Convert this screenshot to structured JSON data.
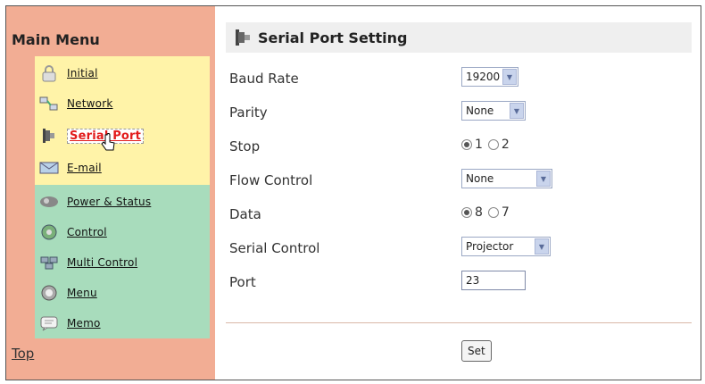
{
  "sidebar": {
    "title": "Main Menu",
    "items": [
      {
        "label": "Initial",
        "icon": "lock-icon"
      },
      {
        "label": "Network",
        "icon": "network-icon"
      },
      {
        "label": "Serial Port",
        "icon": "serial-port-icon",
        "active": true
      },
      {
        "label": "E-mail",
        "icon": "email-icon"
      },
      {
        "label": "Power & Status",
        "icon": "power-icon"
      },
      {
        "label": "Control",
        "icon": "control-icon"
      },
      {
        "label": "Multi Control",
        "icon": "multi-control-icon"
      },
      {
        "label": "Menu",
        "icon": "menu-icon"
      },
      {
        "label": "Memo",
        "icon": "memo-icon"
      }
    ],
    "top_link": "Top"
  },
  "main": {
    "title": "Serial Port Setting",
    "fields": {
      "baud_rate": {
        "label": "Baud Rate",
        "value": "19200"
      },
      "parity": {
        "label": "Parity",
        "value": "None"
      },
      "stop": {
        "label": "Stop",
        "options": [
          "1",
          "2"
        ],
        "selected": "1"
      },
      "flow_control": {
        "label": "Flow Control",
        "value": "None"
      },
      "data": {
        "label": "Data",
        "options": [
          "8",
          "7"
        ],
        "selected": "8"
      },
      "serial_control": {
        "label": "Serial Control",
        "value": "Projector"
      },
      "port": {
        "label": "Port",
        "value": "23"
      }
    },
    "set_label": "Set"
  },
  "colors": {
    "sidebar_bg": "#f2ad94",
    "group_yellow": "#fff3a8",
    "group_green": "#a8dcbc",
    "active_link": "#e21b1b",
    "header_bg": "#efefef"
  }
}
